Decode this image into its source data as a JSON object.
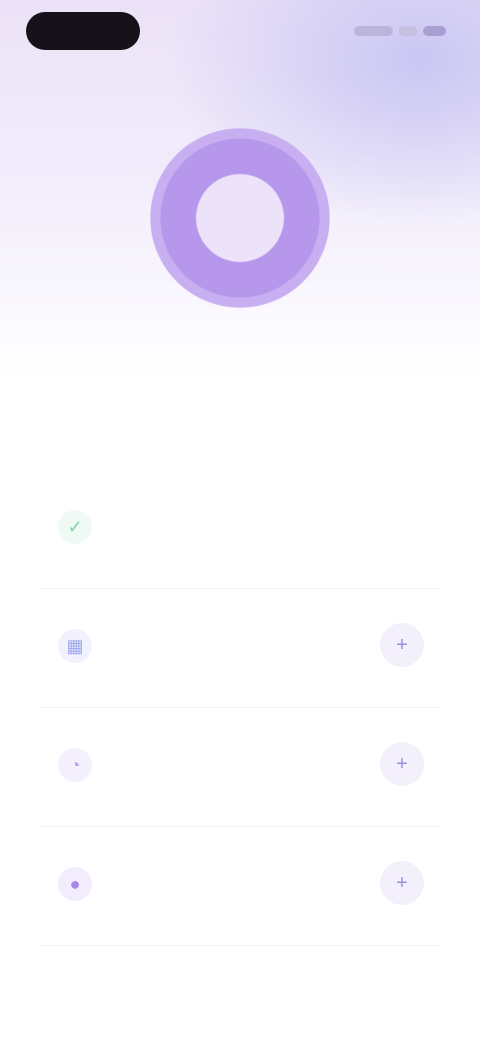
{
  "status_bar": {},
  "hero": {
    "title": "",
    "subtitle": ""
  },
  "items": [
    {
      "label": "",
      "sub": "",
      "icon": "check-circle-icon",
      "color": "#7fd6a6",
      "has_action": false
    },
    {
      "label": "",
      "sub": "",
      "icon": "calendar-icon",
      "color": "#9ea6ec",
      "has_action": true
    },
    {
      "label": "",
      "sub": "",
      "icon": "bell-icon",
      "color": "#b7a6ee",
      "has_action": true
    },
    {
      "label": "",
      "sub": "",
      "icon": "user-icon",
      "color": "#a986ea",
      "has_action": true
    }
  ],
  "colors": {
    "accent": "#b697ec",
    "status_pill": "#161219",
    "background": "#ffffff"
  }
}
